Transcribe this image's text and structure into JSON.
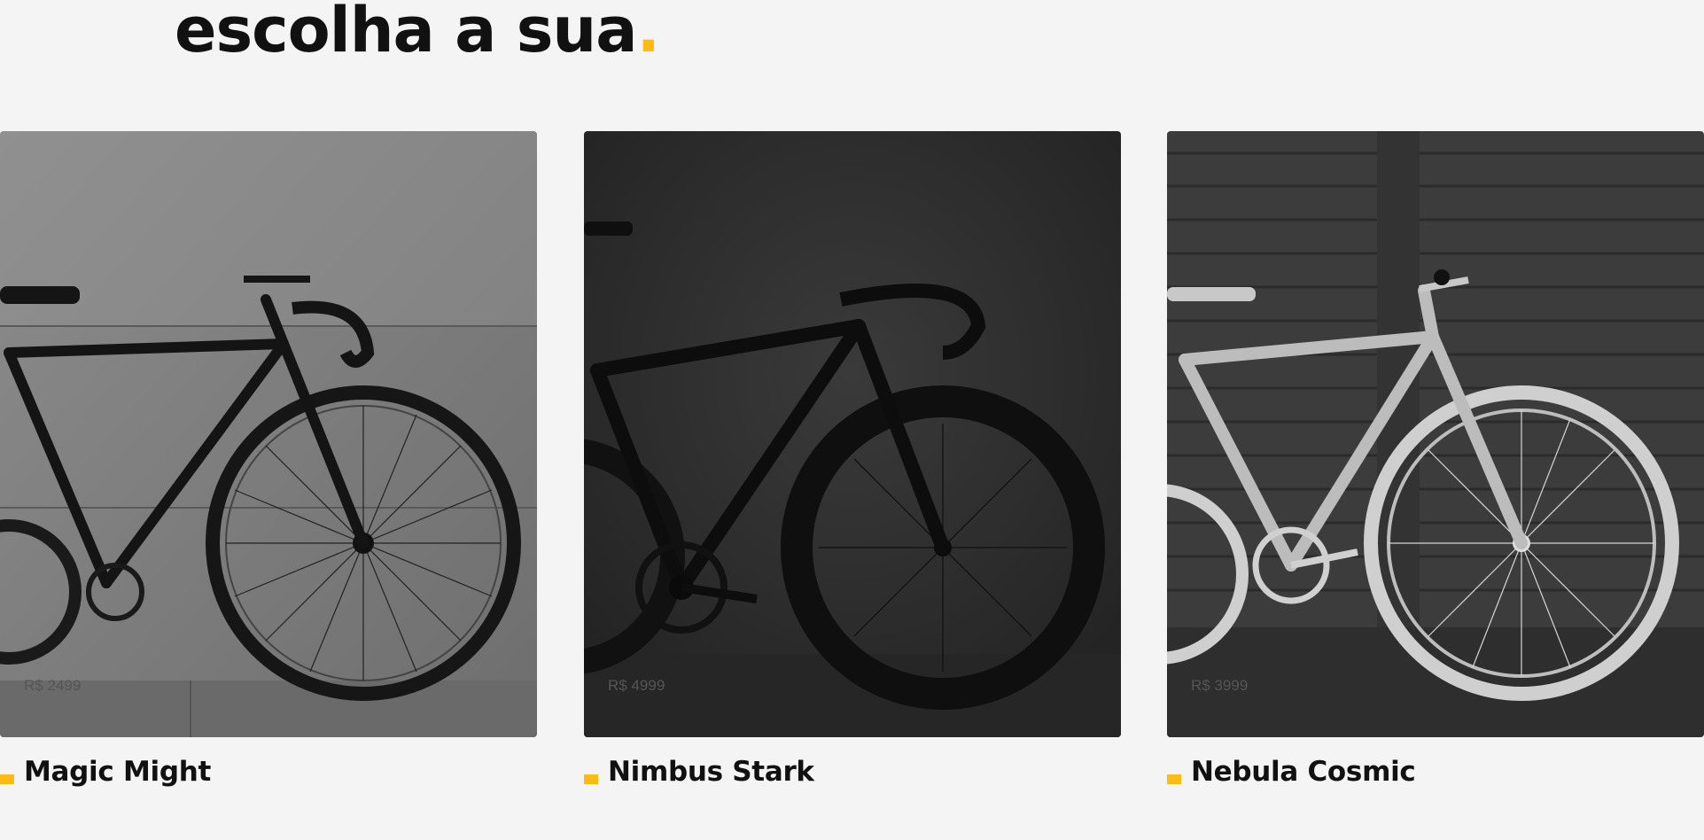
{
  "section": {
    "title": "escolha a sua",
    "title_dot": ".",
    "accent_color": "#ffbb11"
  },
  "products": [
    {
      "name": "Magic Might",
      "price": "R$ 2499",
      "image": "black-fixie-bike-photo"
    },
    {
      "name": "Nimbus Stark",
      "price": "R$ 4999",
      "image": "black-road-bike-photo"
    },
    {
      "name": "Nebula Cosmic",
      "price": "R$ 3999",
      "image": "white-bike-photo"
    }
  ]
}
